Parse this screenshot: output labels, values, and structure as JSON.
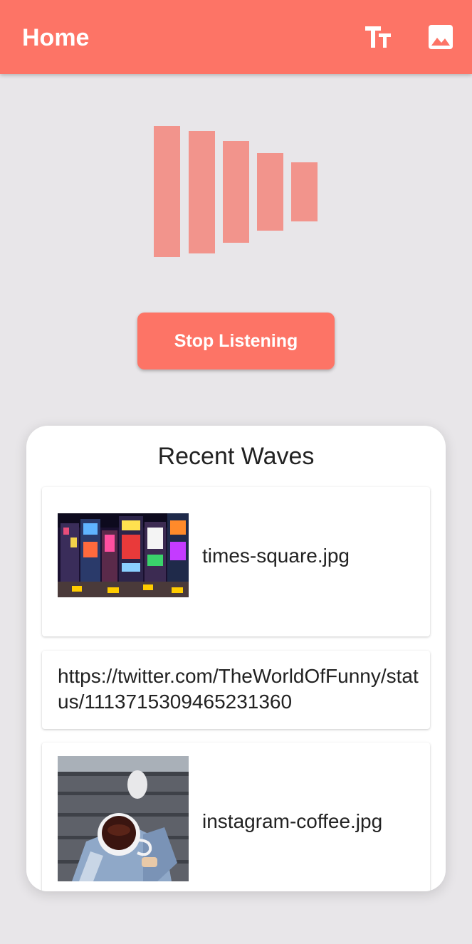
{
  "app_bar": {
    "title": "Home",
    "background": "#fd7466",
    "actions": [
      {
        "icon": "text-size-icon"
      },
      {
        "icon": "image-icon"
      }
    ]
  },
  "wave_visualizer": {
    "bar_count": 5,
    "color": "#f2948c"
  },
  "controls": {
    "stop_label": "Stop Listening"
  },
  "recent": {
    "title": "Recent Waves",
    "items": [
      {
        "type": "image",
        "thumbnail": "times-square-photo",
        "label": "times-square.jpg"
      },
      {
        "type": "link",
        "label": "https://twitter.com/TheWorldOfFunny/status/1113715309465231360"
      },
      {
        "type": "image",
        "thumbnail": "coffee-cup-photo",
        "label": "instagram-coffee.jpg"
      }
    ]
  }
}
